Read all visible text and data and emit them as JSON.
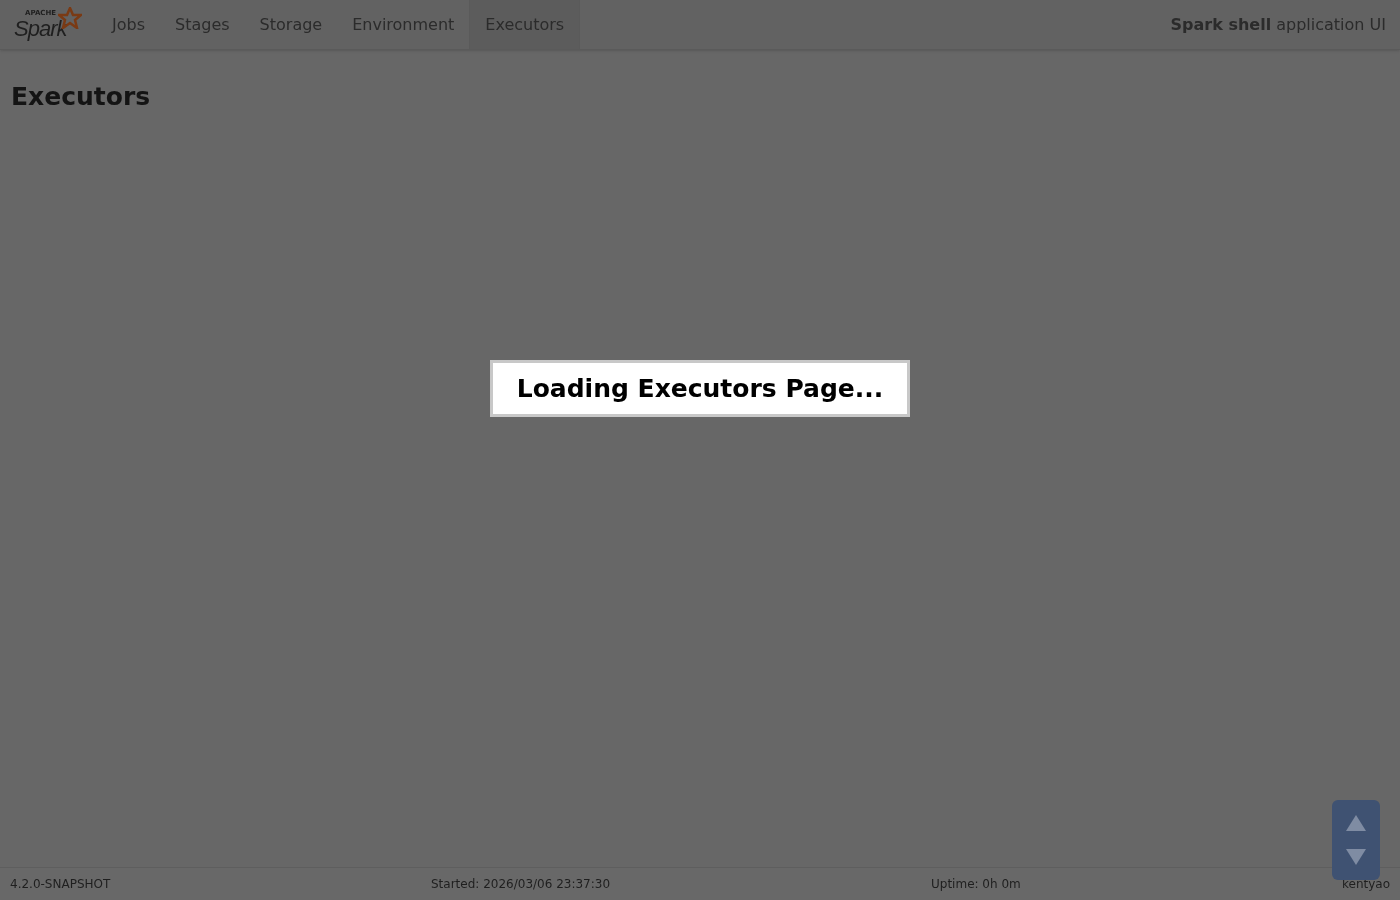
{
  "logo": {
    "small": "APACHE",
    "name": "Spark"
  },
  "nav": [
    {
      "label": "Jobs",
      "selected": false
    },
    {
      "label": "Stages",
      "selected": false
    },
    {
      "label": "Storage",
      "selected": false
    },
    {
      "label": "Environment",
      "selected": false
    },
    {
      "label": "Executors",
      "selected": true
    }
  ],
  "app_title": {
    "bold": "Spark shell",
    "rest": "application UI"
  },
  "heading": "Executors",
  "loading_dialog": "Loading Executors Page...",
  "footer": {
    "version": "4.2.0-SNAPSHOT",
    "started": "Started: 2026/03/06 23:37:30",
    "uptime": "Uptime: 0h 0m",
    "user": "kentyao"
  }
}
